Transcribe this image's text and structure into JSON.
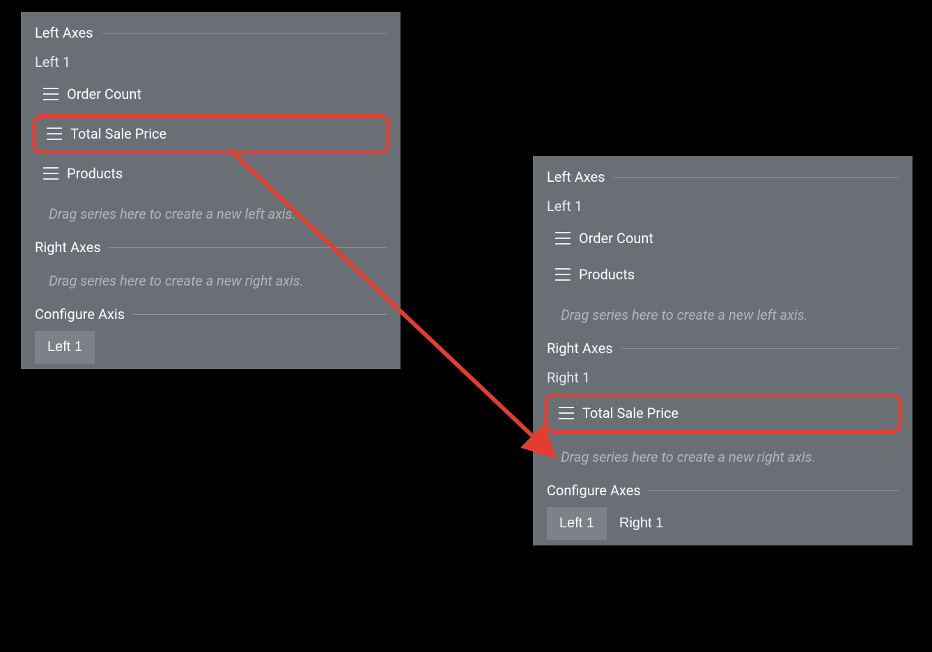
{
  "left_panel": {
    "left_axes_header": "Left Axes",
    "left1_label": "Left 1",
    "series": [
      {
        "label": "Order Count"
      },
      {
        "label": "Total Sale Price"
      },
      {
        "label": "Products"
      }
    ],
    "left_drop_hint": "Drag series here to create a new left axis.",
    "right_axes_header": "Right Axes",
    "right_drop_hint": "Drag series here to create a new right axis.",
    "configure_header": "Configure Axis",
    "tabs": [
      {
        "label": "Left 1"
      }
    ]
  },
  "right_panel": {
    "left_axes_header": "Left Axes",
    "left1_label": "Left 1",
    "left_series": [
      {
        "label": "Order Count"
      },
      {
        "label": "Products"
      }
    ],
    "left_drop_hint": "Drag series here to create a new left axis.",
    "right_axes_header": "Right Axes",
    "right1_label": "Right 1",
    "right_series": [
      {
        "label": "Total Sale Price"
      }
    ],
    "right_drop_hint": "Drag series here to create a new right axis.",
    "configure_header": "Configure Axes",
    "tabs": [
      {
        "label": "Left 1"
      },
      {
        "label": "Right 1"
      }
    ]
  },
  "colors": {
    "highlight": "#e43d2f"
  }
}
